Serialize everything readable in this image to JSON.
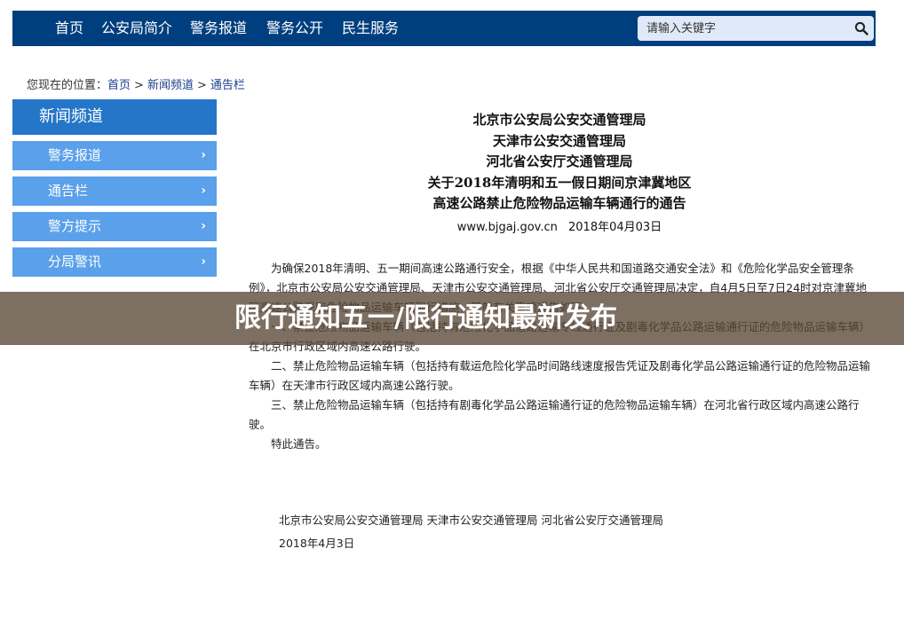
{
  "nav": {
    "items": [
      "首页",
      "公安局简介",
      "警务报道",
      "警务公开",
      "民生服务"
    ],
    "search_placeholder": "请输入关键字"
  },
  "breadcrumb": {
    "prefix": "您现在的位置：",
    "items": [
      "首页",
      "新闻频道",
      "通告栏"
    ],
    "separator": ">"
  },
  "sidebar": {
    "title": "新闻频道",
    "items": [
      "警务报道",
      "通告栏",
      "警方提示",
      "分局警讯"
    ],
    "chevron": "›"
  },
  "article": {
    "heading": [
      "北京市公安局公安交通管理局",
      "天津市公安交通管理局",
      "河北省公安厅交通管理局",
      "关于2018年清明和五一假日期间京津冀地区",
      "高速公路禁止危险物品运输车辆通行的通告"
    ],
    "source": "www.bjgaj.gov.cn",
    "date": "2018年04月03日",
    "paragraphs": [
      "为确保2018年清明、五一期间高速公路通行安全，根据《中华人民共和国道路交通安全法》和《危险化学品安全管理条例》，北京市公安局公安交通管理局、天津市公安交通管理局、河北省公安厅交通管理局决定，自4月5日至7日24时对京津冀地区高速公路采取危险物品运输车辆限行措施，现就有关事项通告如下：",
      "一、禁止危险物品运输车辆（包括持有危险化学品道路运输专线通行证及剧毒化学品公路运输通行证的危险物品运输车辆）在北京市行政区域内高速公路行驶。",
      "二、禁止危险物品运输车辆（包括持有载运危险化学品时间路线速度报告凭证及剧毒化学品公路运输通行证的危险物品运输车辆）在天津市行政区域内高速公路行驶。",
      "三、禁止危险物品运输车辆（包括持有剧毒化学品公路运输通行证的危险物品运输车辆）在河北省行政区域内高速公路行驶。",
      "特此通告。"
    ],
    "signature": "北京市公安局公安交通管理局 天津市公安交通管理局 河北省公安厅交通管理局",
    "signature_date": "2018年4月3日"
  },
  "banner": {
    "title": "限行通知五一/限行通知最新发布"
  },
  "colors": {
    "nav_bg": "#003f7f",
    "sidebar_title_bg": "#2576c8",
    "sidebar_item_bg": "#5aa0ea",
    "search_bg": "#dfe9f7",
    "banner_bg": "#5a4637"
  }
}
